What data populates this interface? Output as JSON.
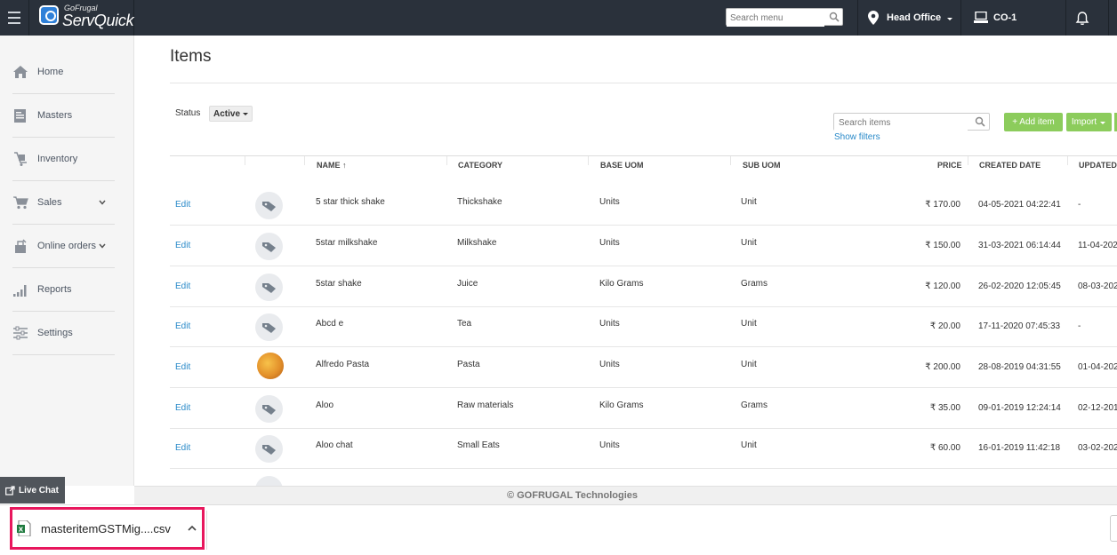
{
  "header": {
    "brand_small": "GoFrugal",
    "brand_name": "ServQuick",
    "search_placeholder": "Search menu",
    "location": "Head Office",
    "counter": "CO-1"
  },
  "sidebar": {
    "items": [
      {
        "label": "Home",
        "icon": "home-icon"
      },
      {
        "label": "Masters",
        "icon": "masters-icon"
      },
      {
        "label": "Inventory",
        "icon": "inventory-icon"
      },
      {
        "label": "Sales",
        "icon": "cart-icon"
      },
      {
        "label": "Online orders",
        "icon": "online-orders-icon"
      },
      {
        "label": "Reports",
        "icon": "reports-icon"
      },
      {
        "label": "Settings",
        "icon": "settings-icon"
      }
    ]
  },
  "main": {
    "title": "Items",
    "status_label": "Status",
    "status_value": "Active",
    "search_placeholder": "Search items",
    "show_filters": "Show filters",
    "add_item": "+ Add item",
    "import": "Import"
  },
  "table": {
    "columns": [
      "NAME",
      "CATEGORY",
      "BASE UOM",
      "SUB UOM",
      "PRICE",
      "CREATED DATE",
      "UPDATED"
    ],
    "edit_label": "Edit",
    "rows": [
      {
        "name": "5 star thick shake",
        "category": "Thickshake",
        "base_uom": "Units",
        "sub_uom": "Unit",
        "price": "₹ 170.00",
        "created": "04-05-2021 04:22:41",
        "updated": "-",
        "image": "tag"
      },
      {
        "name": "5star milkshake",
        "category": "Milkshake",
        "base_uom": "Units",
        "sub_uom": "Unit",
        "price": "₹ 150.00",
        "created": "31-03-2021 06:14:44",
        "updated": "11-04-202",
        "image": "tag"
      },
      {
        "name": "5star shake",
        "category": "Juice",
        "base_uom": "Kilo Grams",
        "sub_uom": "Grams",
        "price": "₹ 120.00",
        "created": "26-02-2020 12:05:45",
        "updated": "08-03-202",
        "image": "tag"
      },
      {
        "name": "Abcd e",
        "category": "Tea",
        "base_uom": "Units",
        "sub_uom": "Unit",
        "price": "₹ 20.00",
        "created": "17-11-2020 07:45:33",
        "updated": "-",
        "image": "tag"
      },
      {
        "name": "Alfredo Pasta",
        "category": "Pasta",
        "base_uom": "Units",
        "sub_uom": "Unit",
        "price": "₹ 200.00",
        "created": "28-08-2019 04:31:55",
        "updated": "01-04-202",
        "image": "photo"
      },
      {
        "name": "Aloo",
        "category": "Raw materials",
        "base_uom": "Kilo Grams",
        "sub_uom": "Grams",
        "price": "₹ 35.00",
        "created": "09-01-2019 12:24:14",
        "updated": "02-12-201",
        "image": "tag"
      },
      {
        "name": "Aloo chat",
        "category": "Small Eats",
        "base_uom": "Units",
        "sub_uom": "Unit",
        "price": "₹ 60.00",
        "created": "16-01-2019 11:42:18",
        "updated": "03-02-202",
        "image": "tag"
      }
    ]
  },
  "footer": {
    "text": "© GOFRUGAL Technologies"
  },
  "live_chat": "Live Chat",
  "download": {
    "filename": "masteritemGSTMig....csv"
  },
  "colors": {
    "topbar": "#2a313b",
    "accent_green": "#8ccc5c",
    "link_blue": "#2a8ac9",
    "highlight": "#e8175d"
  }
}
